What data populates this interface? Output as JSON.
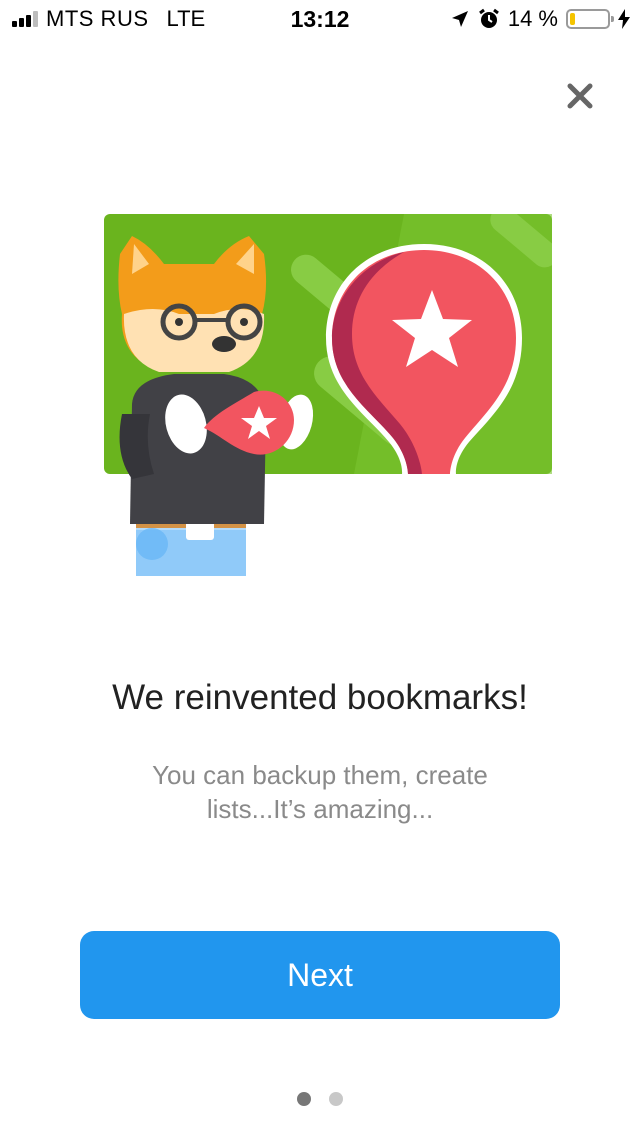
{
  "status_bar": {
    "carrier": "MTS RUS",
    "network": "LTE",
    "time": "13:12",
    "battery_percent": "14 %",
    "battery_level": 0.14,
    "icons": [
      "signal-icon",
      "location-arrow-icon",
      "alarm-icon",
      "battery-icon",
      "charging-bolt-icon"
    ]
  },
  "onboarding": {
    "close_icon": "close-icon",
    "headline": "We reinvented bookmarks!",
    "subtitle": "You can backup them, create lists...It’s amazing...",
    "next_label": "Next",
    "pager": {
      "count": 2,
      "active_index": 0
    }
  },
  "colors": {
    "accent": "#2196ee",
    "illustration_green": "#6ab41e",
    "pin_red": "#f25560",
    "dot_active": "#777777",
    "dot_inactive": "#c8c8c8"
  }
}
